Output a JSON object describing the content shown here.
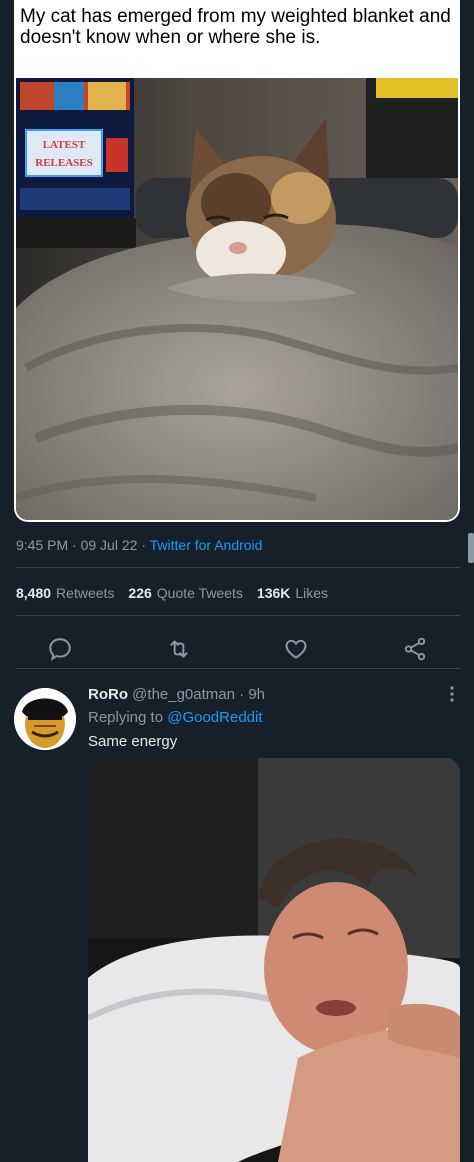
{
  "meme": {
    "title": "My cat has emerged from my weighted blanket and doesn't know when or where she is.",
    "tv_sign": "LATEST RELEASES"
  },
  "tweet": {
    "time": "9:45 PM",
    "date": "09 Jul 22",
    "source": "Twitter for Android",
    "retweets_count": "8,480",
    "retweets_label": "Retweets",
    "quotes_count": "226",
    "quotes_label": "Quote Tweets",
    "likes_count": "136K",
    "likes_label": "Likes"
  },
  "reply": {
    "name": "RoRo",
    "handle": "@the_g0atman",
    "age": "9h",
    "replying_prefix": "Replying to",
    "replying_to": "@GoodReddit",
    "text": "Same energy"
  },
  "icons": [
    "reply-icon",
    "retweet-icon",
    "like-icon",
    "share-icon",
    "more-icon"
  ],
  "colors": {
    "background": "#15202b",
    "accent": "#1d9bf0",
    "muted": "#8b98a5",
    "divider": "#38444d"
  }
}
